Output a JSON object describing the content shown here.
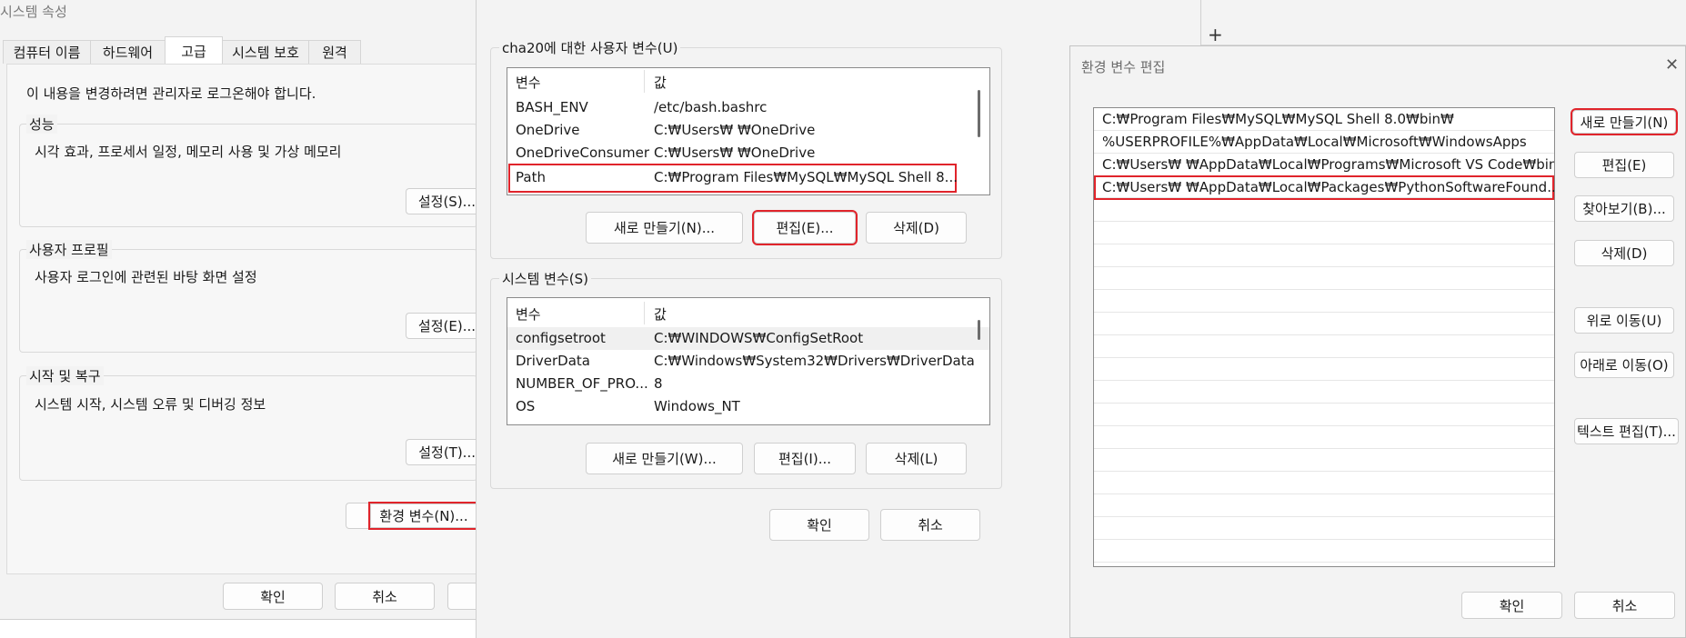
{
  "system_properties": {
    "title": "시스템 속성",
    "tabs": [
      {
        "label": "컴퓨터 이름"
      },
      {
        "label": "하드웨어"
      },
      {
        "label": "고급"
      },
      {
        "label": "시스템 보호"
      },
      {
        "label": "원격"
      }
    ],
    "active_tab": "고급",
    "admin_notice": "이 내용을 변경하려면 관리자로 로그온해야 합니다.",
    "performance": {
      "title": "성능",
      "description": "시각 효과, 프로세서 일정, 메모리 사용 및 가상 메모리",
      "button": "설정(S)..."
    },
    "user_profiles": {
      "title": "사용자 프로필",
      "description": "사용자 로그인에 관련된 바탕 화면 설정",
      "button": "설정(E)..."
    },
    "startup_recovery": {
      "title": "시작 및 복구",
      "description": "시스템 시작, 시스템 오류 및 디버깅 정보",
      "button": "설정(T)..."
    },
    "env_vars_button": "환경 변수(N)...",
    "ok_button": "확인",
    "cancel_button": "취소"
  },
  "environment_variables": {
    "user_vars": {
      "title": "cha20에 대한 사용자 변수(U)",
      "col_variable": "변수",
      "col_value": "값",
      "rows": [
        {
          "name": "BASH_ENV",
          "value": "/etc/bash.bashrc"
        },
        {
          "name": "OneDrive",
          "value": "C:₩Users₩         ₩OneDrive"
        },
        {
          "name": "OneDriveConsumer",
          "value": "C:₩Users₩         ₩OneDrive"
        },
        {
          "name": "Path",
          "value": "C:₩Program Files₩MySQL₩MySQL Shell 8...",
          "highlighted": true
        }
      ],
      "new_button": "새로 만들기(N)...",
      "edit_button": "편집(E)...",
      "delete_button": "삭제(D)"
    },
    "system_vars": {
      "title": "시스템 변수(S)",
      "col_variable": "변수",
      "col_value": "값",
      "rows": [
        {
          "name": "configsetroot",
          "value": "C:₩WINDOWS₩ConfigSetRoot"
        },
        {
          "name": "DriverData",
          "value": "C:₩Windows₩System32₩Drivers₩DriverData"
        },
        {
          "name": "NUMBER_OF_PRO...",
          "value": "8"
        },
        {
          "name": "OS",
          "value": "Windows_NT"
        }
      ],
      "new_button": "새로 만들기(W)...",
      "edit_button": "편집(I)...",
      "delete_button": "삭제(L)"
    },
    "ok_button": "확인",
    "cancel_button": "취소"
  },
  "background_window": {
    "new_tab_label": "+"
  },
  "edit_env_var": {
    "title": "환경 변수 편집",
    "close_label": "✕",
    "entries": [
      "C:₩Program Files₩MySQL₩MySQL Shell 8.0₩bin₩",
      "%USERPROFILE%₩AppData₩Local₩Microsoft₩WindowsApps",
      "C:₩Users₩          ₩AppData₩Local₩Programs₩Microsoft VS Code₩bin",
      "C:₩Users₩          ₩AppData₩Local₩Packages₩PythonSoftwareFound..."
    ],
    "highlighted_entry_index": 3,
    "buttons": {
      "new": "새로 만들기(N)",
      "edit": "편집(E)",
      "browse": "찾아보기(B)...",
      "delete": "삭제(D)",
      "move_up": "위로 이동(U)",
      "move_down": "아래로 이동(O)",
      "edit_text": "텍스트 편집(T)..."
    },
    "ok_button": "확인",
    "cancel_button": "취소"
  },
  "colors": {
    "highlight_outline": "#e0242b",
    "window_bg": "#f3f3f3",
    "list_bg": "#ffffff"
  }
}
